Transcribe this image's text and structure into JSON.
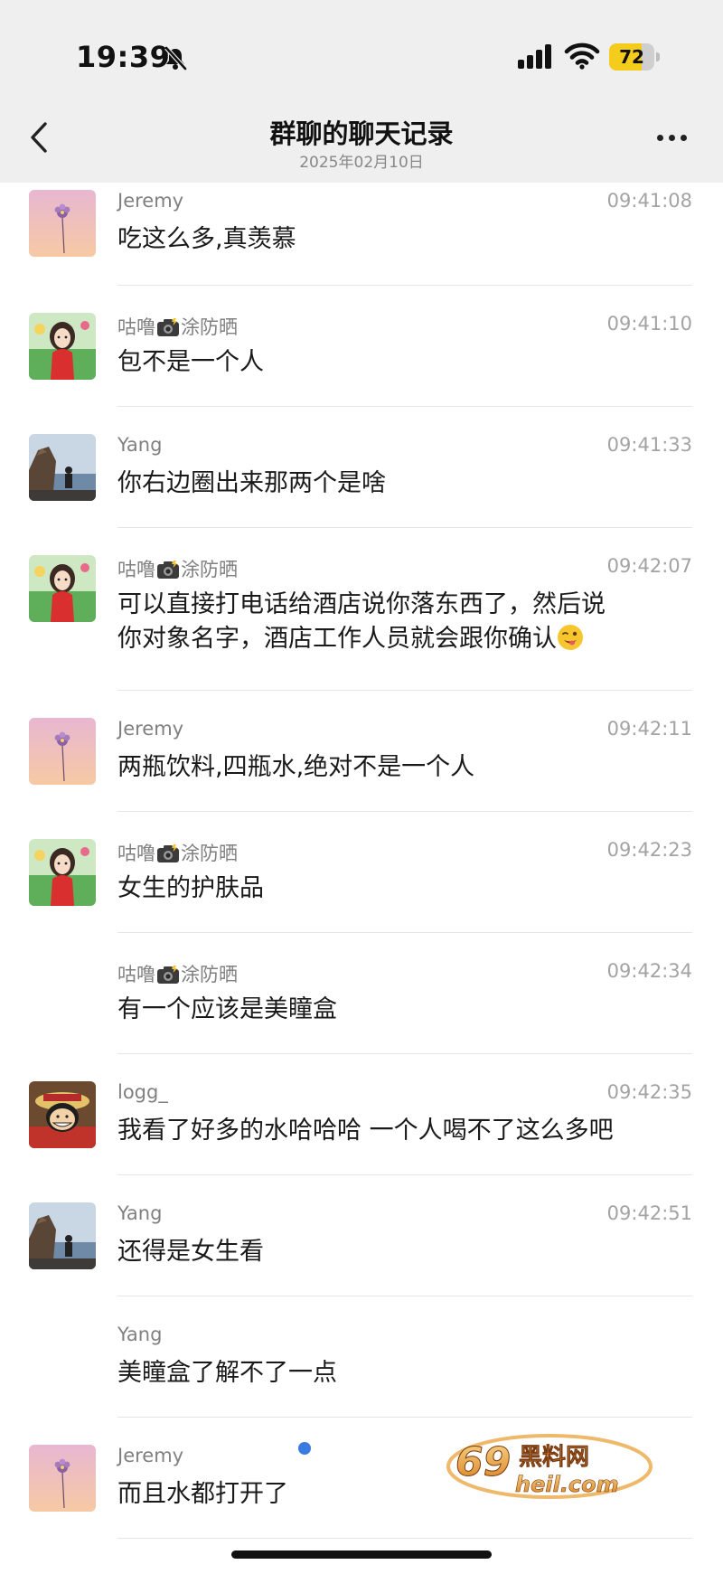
{
  "status_bar": {
    "time": "19:39",
    "battery_level": "72",
    "battery_fraction": 0.72
  },
  "nav": {
    "title": "群聊的聊天记录",
    "subtitle": "2025年02月10日"
  },
  "messages": [
    {
      "sender": "Jeremy",
      "time": "09:41:08",
      "text": "吃这么多,真羡慕",
      "avatar": "flower-avatar"
    },
    {
      "sender_before": "咕噜",
      "sender_after": "涂防晒",
      "time": "09:41:10",
      "text": "包不是一个人",
      "avatar": "cartoon-girl-avatar"
    },
    {
      "sender": "Yang",
      "time": "09:41:33",
      "text": "你右边圈出来那两个是啥",
      "avatar": "seaside-photo-avatar"
    },
    {
      "sender_before": "咕噜",
      "sender_after": "涂防晒",
      "time": "09:42:07",
      "text_line1": "可以直接打电话给酒店说你落东西了，然后说",
      "text_line2": "你对象名字，酒店工作人员就会跟你确认",
      "emoji": "winking-face-emoji",
      "avatar": "cartoon-girl-avatar"
    },
    {
      "sender": "Jeremy",
      "time": "09:42:11",
      "text": "两瓶饮料,四瓶水,绝对不是一个人",
      "avatar": "flower-avatar"
    },
    {
      "sender_before": "咕噜",
      "sender_after": "涂防晒",
      "time": "09:42:23",
      "text": "女生的护肤品",
      "avatar": "cartoon-girl-avatar"
    },
    {
      "sender_before": "咕噜",
      "sender_after": "涂防晒",
      "time": "09:42:34",
      "text": "有一个应该是美瞳盒"
    },
    {
      "sender": "logg_",
      "time": "09:42:35",
      "text": "我看了好多的水哈哈哈 一个人喝不了这么多吧",
      "avatar": "anime-boy-avatar"
    },
    {
      "sender": "Yang",
      "time": "09:42:51",
      "text": "还得是女生看",
      "avatar": "seaside-photo-avatar"
    },
    {
      "sender": "Yang",
      "time": "",
      "text": "美瞳盒了解不了一点"
    },
    {
      "sender": "Jeremy",
      "time": "",
      "text": "而且水都打开了",
      "avatar": "flower-avatar"
    }
  ],
  "watermark": {
    "line1": "69黑料网",
    "line2": "heil.com"
  },
  "icons": {
    "back": "chevron-left-icon",
    "more": "more-dots-icon",
    "mute": "bell-slash-icon",
    "signal": "signal-icon",
    "wifi": "wifi-icon",
    "camera": "camera-flash-emoji"
  },
  "colors": {
    "header_bg": "#efefef",
    "battery": "#f4cd1c",
    "sender": "#808080",
    "timestamp": "#a3a3a3",
    "divider": "#e6e6e6"
  }
}
